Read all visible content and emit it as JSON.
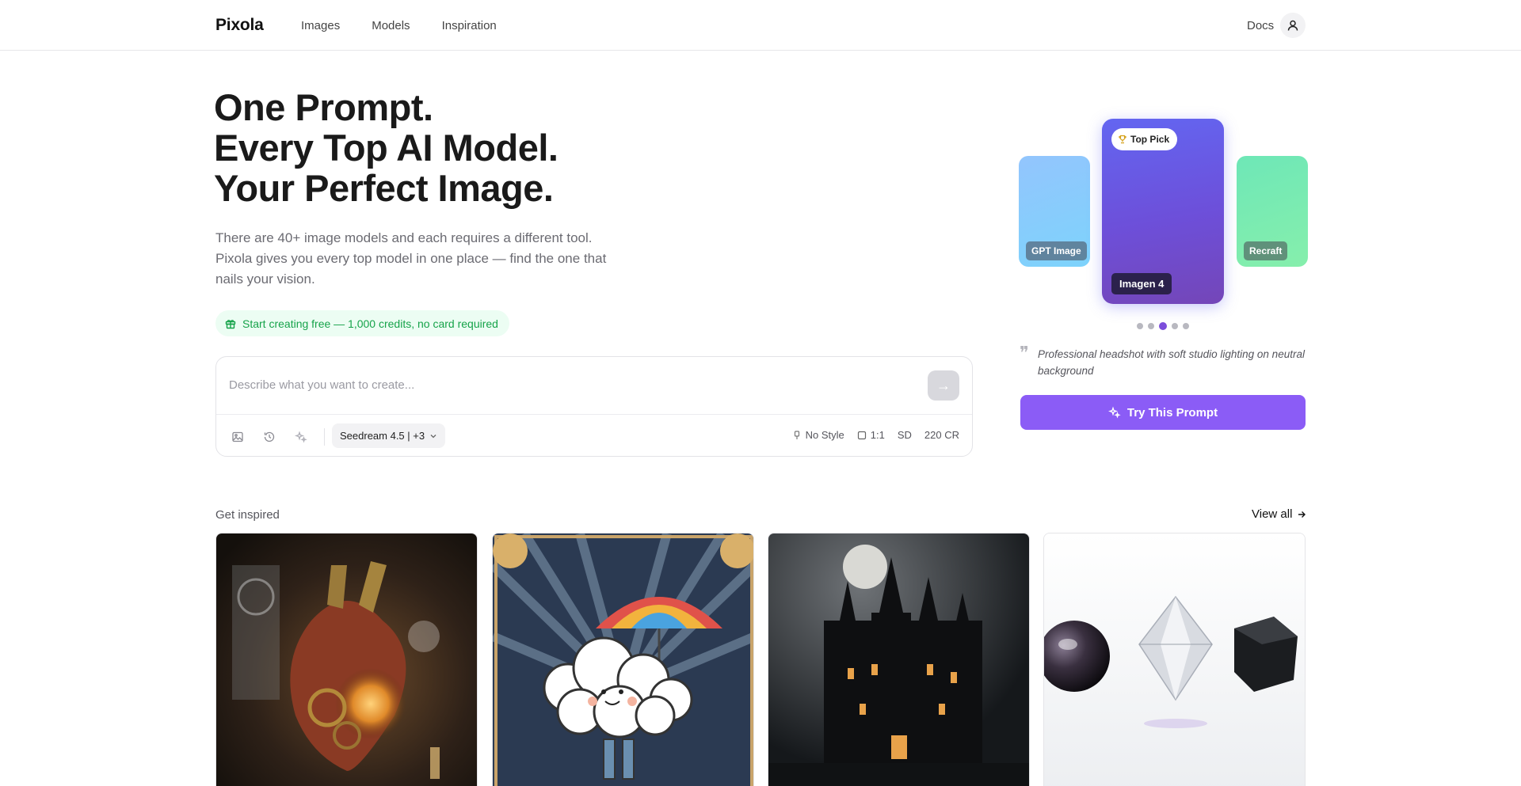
{
  "header": {
    "logo": "Pixola",
    "nav": [
      "Images",
      "Models",
      "Inspiration"
    ],
    "docs": "Docs"
  },
  "hero": {
    "title_lines": [
      "One Prompt.",
      "Every Top AI Model.",
      "Your Perfect Image."
    ],
    "subtitle": "There are 40+ image models and each requires a different tool. Pixola gives you every top model in one place — find the one that nails your vision.",
    "free_pill": "Start creating free — 1,000 credits, no card required"
  },
  "prompt": {
    "placeholder": "Describe what you want to create...",
    "value": "",
    "model": "Seedream 4.5 | +3",
    "style": "No Style",
    "ratio": "1:1",
    "quality": "SD",
    "credits": "220 CR"
  },
  "carousel": {
    "cards": [
      {
        "label": "GPT Image",
        "color": "#93c5fd"
      },
      {
        "label": "Imagen 4",
        "color": "#6366f1"
      },
      {
        "label": "Recraft",
        "color": "#6ee7b7"
      }
    ],
    "badge": "Top Pick",
    "dots_total": 5,
    "active_dot": 3,
    "quote": "Professional headshot with soft studio lighting on neutral background",
    "try_button": "Try This Prompt"
  },
  "inspiration": {
    "label": "Get inspired",
    "view_all": "View all",
    "images": [
      {
        "name": "steampunk-heart-image"
      },
      {
        "name": "rainbow-umbrella-cloud-image"
      },
      {
        "name": "gothic-castle-image"
      },
      {
        "name": "crystal-shapes-image"
      }
    ]
  },
  "colors": {
    "accent": "#8b5cf6",
    "green": "#16a34a",
    "active_dot": "#7c4ddb"
  }
}
